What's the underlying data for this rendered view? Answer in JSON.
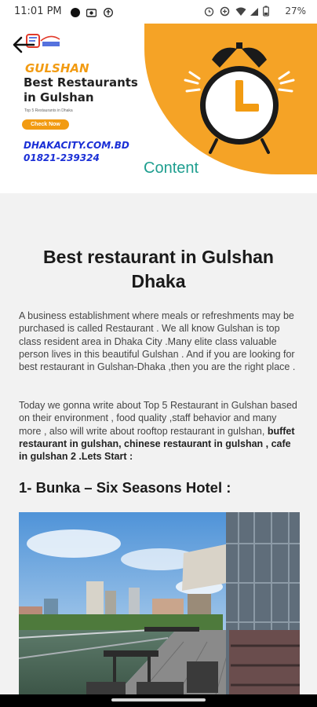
{
  "status_bar": {
    "time": "11:01 PM",
    "battery": "27%"
  },
  "banner": {
    "location": "GULSHAN",
    "headline": "Best Restaurants in Gulshan",
    "small_text": "Top 5 Restaurants in Dhaka",
    "button_label": "Check Now",
    "website": "DHAKACITY.COM.BD",
    "phone": "01821-239324",
    "overlay_text": "Content",
    "accent_color": "#f5a326"
  },
  "article": {
    "title": "Best restaurant in Gulshan Dhaka",
    "paragraph1": "A business establishment where meals or refreshments may be purchased is called Restaurant . We all know Gulshan is top class resident area in Dhaka City .Many elite class valuable person lives in this beautiful Gulshan . And if you are looking for best restaurant in Gulshan-Dhaka ,then you are the right place .",
    "paragraph2_plain": "Today we gonna write about Top 5 Restaurant in Gulshan based on their environment , food quality ,staff behavior and many more , also will write about  rooftop restaurant in gulshan, ",
    "paragraph2_bold": "buffet restaurant in gulshan, chinese restaurant in gulshan , cafe in gulshan 2 .Lets Start :",
    "section_heading": "1- Bunka – Six Seasons Hotel :"
  }
}
